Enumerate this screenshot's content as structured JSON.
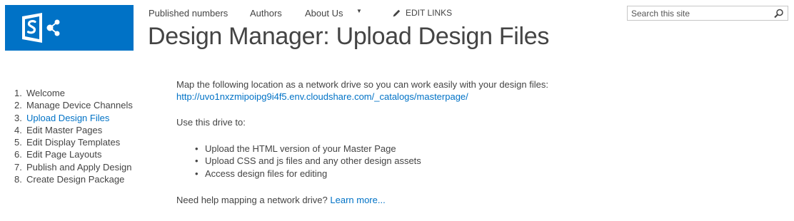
{
  "colors": {
    "brand": "#0072c6",
    "text": "#444444",
    "link": "#0072c6"
  },
  "logo": {
    "icon": "sharepoint-logo-icon"
  },
  "topnav": {
    "items": [
      "Published numbers",
      "Authors",
      "About Us"
    ],
    "dropdown_icon": "caret-down-icon",
    "edit_links_icon": "pencil-icon",
    "edit_links": "EDIT LINKS"
  },
  "search": {
    "placeholder": "Search this site",
    "icon": "search-icon"
  },
  "title": "Design Manager: Upload Design Files",
  "steps": [
    {
      "num": "1.",
      "label": "Welcome"
    },
    {
      "num": "2.",
      "label": "Manage Device Channels"
    },
    {
      "num": "3.",
      "label": "Upload Design Files",
      "active": true
    },
    {
      "num": "4.",
      "label": "Edit Master Pages"
    },
    {
      "num": "5.",
      "label": "Edit Display Templates"
    },
    {
      "num": "6.",
      "label": "Edit Page Layouts"
    },
    {
      "num": "7.",
      "label": "Publish and Apply Design"
    },
    {
      "num": "8.",
      "label": "Create Design Package"
    }
  ],
  "content": {
    "intro": "Map the following location as a network drive so you can work easily with your design files:",
    "url": "http://uvo1nxzmipoipg9i4f5.env.cloudshare.com/_catalogs/masterpage/",
    "use_heading": "Use this drive to:",
    "bullets": [
      "Upload the HTML version of your Master Page",
      "Upload CSS and js files and any other design assets",
      "Access design files for editing"
    ],
    "help_text": "Need help mapping a network drive?",
    "help_link": "Learn more..."
  }
}
